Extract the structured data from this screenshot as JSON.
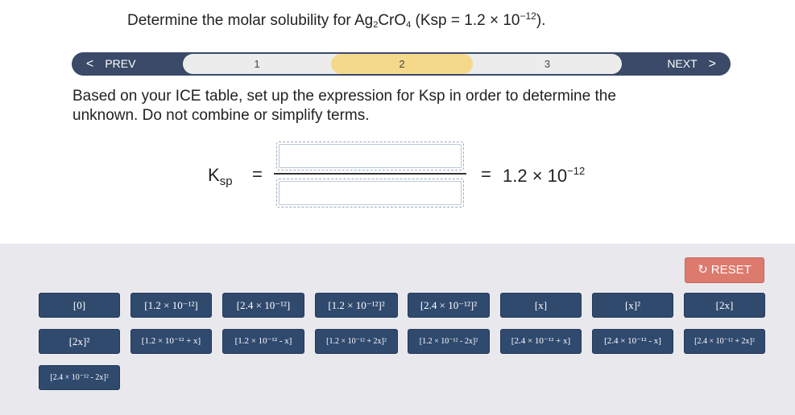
{
  "question": {
    "prefix": "Determine the molar solubility for Ag",
    "sub1": "2",
    "mid": "CrO",
    "sub2": "4",
    "mid2": " (Ksp = 1.2 × 10",
    "exp": "−12",
    "suffix": ")."
  },
  "nav": {
    "prev_label": "PREV",
    "next_label": "NEXT",
    "steps": [
      "1",
      "2",
      "3"
    ],
    "active_step": "2"
  },
  "instruction": "Based on your ICE table, set up the expression for Ksp in order to determine the unknown. Do not combine or simplify terms.",
  "equation": {
    "lhs": "K",
    "lhs_sub": "sp",
    "equals1": "=",
    "equals2": "=",
    "rhs_base": "1.2 × 10",
    "rhs_exp": "−12"
  },
  "reset_label": "RESET",
  "tiles": [
    "[0]",
    "[1.2 × 10⁻¹²]",
    "[2.4 × 10⁻¹²]",
    "[1.2 × 10⁻¹²]²",
    "[2.4 × 10⁻¹²]²",
    "[x]",
    "[x]²",
    "[2x]",
    "[2x]²",
    "[1.2 × 10⁻¹² + x]",
    "[1.2 × 10⁻¹² - x]",
    "[1.2 × 10⁻¹² + 2x]²",
    "[1.2 × 10⁻¹² - 2x]²",
    "[2.4 × 10⁻¹² + x]",
    "[2.4 × 10⁻¹² - x]",
    "[2.4 × 10⁻¹² + 2x]²",
    "[2.4 × 10⁻¹² - 2x]²"
  ],
  "colors": {
    "nav_bg": "#3a4a68",
    "active_step": "#f5d98b",
    "tile_bg": "#304a6e",
    "reset_bg": "#dd7a6e",
    "panel_bg": "#e9e9ed"
  }
}
